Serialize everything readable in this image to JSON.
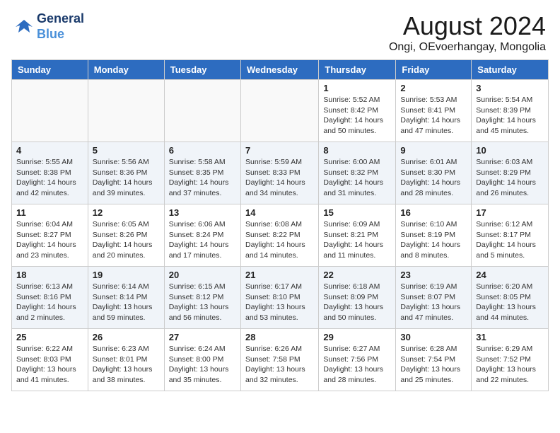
{
  "header": {
    "logo_line1": "General",
    "logo_line2": "Blue",
    "month_year": "August 2024",
    "location": "Ongi, OEvoerhangay, Mongolia"
  },
  "weekdays": [
    "Sunday",
    "Monday",
    "Tuesday",
    "Wednesday",
    "Thursday",
    "Friday",
    "Saturday"
  ],
  "weeks": [
    [
      {
        "day": "",
        "info": ""
      },
      {
        "day": "",
        "info": ""
      },
      {
        "day": "",
        "info": ""
      },
      {
        "day": "",
        "info": ""
      },
      {
        "day": "1",
        "info": "Sunrise: 5:52 AM\nSunset: 8:42 PM\nDaylight: 14 hours and 50 minutes."
      },
      {
        "day": "2",
        "info": "Sunrise: 5:53 AM\nSunset: 8:41 PM\nDaylight: 14 hours and 47 minutes."
      },
      {
        "day": "3",
        "info": "Sunrise: 5:54 AM\nSunset: 8:39 PM\nDaylight: 14 hours and 45 minutes."
      }
    ],
    [
      {
        "day": "4",
        "info": "Sunrise: 5:55 AM\nSunset: 8:38 PM\nDaylight: 14 hours and 42 minutes."
      },
      {
        "day": "5",
        "info": "Sunrise: 5:56 AM\nSunset: 8:36 PM\nDaylight: 14 hours and 39 minutes."
      },
      {
        "day": "6",
        "info": "Sunrise: 5:58 AM\nSunset: 8:35 PM\nDaylight: 14 hours and 37 minutes."
      },
      {
        "day": "7",
        "info": "Sunrise: 5:59 AM\nSunset: 8:33 PM\nDaylight: 14 hours and 34 minutes."
      },
      {
        "day": "8",
        "info": "Sunrise: 6:00 AM\nSunset: 8:32 PM\nDaylight: 14 hours and 31 minutes."
      },
      {
        "day": "9",
        "info": "Sunrise: 6:01 AM\nSunset: 8:30 PM\nDaylight: 14 hours and 28 minutes."
      },
      {
        "day": "10",
        "info": "Sunrise: 6:03 AM\nSunset: 8:29 PM\nDaylight: 14 hours and 26 minutes."
      }
    ],
    [
      {
        "day": "11",
        "info": "Sunrise: 6:04 AM\nSunset: 8:27 PM\nDaylight: 14 hours and 23 minutes."
      },
      {
        "day": "12",
        "info": "Sunrise: 6:05 AM\nSunset: 8:26 PM\nDaylight: 14 hours and 20 minutes."
      },
      {
        "day": "13",
        "info": "Sunrise: 6:06 AM\nSunset: 8:24 PM\nDaylight: 14 hours and 17 minutes."
      },
      {
        "day": "14",
        "info": "Sunrise: 6:08 AM\nSunset: 8:22 PM\nDaylight: 14 hours and 14 minutes."
      },
      {
        "day": "15",
        "info": "Sunrise: 6:09 AM\nSunset: 8:21 PM\nDaylight: 14 hours and 11 minutes."
      },
      {
        "day": "16",
        "info": "Sunrise: 6:10 AM\nSunset: 8:19 PM\nDaylight: 14 hours and 8 minutes."
      },
      {
        "day": "17",
        "info": "Sunrise: 6:12 AM\nSunset: 8:17 PM\nDaylight: 14 hours and 5 minutes."
      }
    ],
    [
      {
        "day": "18",
        "info": "Sunrise: 6:13 AM\nSunset: 8:16 PM\nDaylight: 14 hours and 2 minutes."
      },
      {
        "day": "19",
        "info": "Sunrise: 6:14 AM\nSunset: 8:14 PM\nDaylight: 13 hours and 59 minutes."
      },
      {
        "day": "20",
        "info": "Sunrise: 6:15 AM\nSunset: 8:12 PM\nDaylight: 13 hours and 56 minutes."
      },
      {
        "day": "21",
        "info": "Sunrise: 6:17 AM\nSunset: 8:10 PM\nDaylight: 13 hours and 53 minutes."
      },
      {
        "day": "22",
        "info": "Sunrise: 6:18 AM\nSunset: 8:09 PM\nDaylight: 13 hours and 50 minutes."
      },
      {
        "day": "23",
        "info": "Sunrise: 6:19 AM\nSunset: 8:07 PM\nDaylight: 13 hours and 47 minutes."
      },
      {
        "day": "24",
        "info": "Sunrise: 6:20 AM\nSunset: 8:05 PM\nDaylight: 13 hours and 44 minutes."
      }
    ],
    [
      {
        "day": "25",
        "info": "Sunrise: 6:22 AM\nSunset: 8:03 PM\nDaylight: 13 hours and 41 minutes."
      },
      {
        "day": "26",
        "info": "Sunrise: 6:23 AM\nSunset: 8:01 PM\nDaylight: 13 hours and 38 minutes."
      },
      {
        "day": "27",
        "info": "Sunrise: 6:24 AM\nSunset: 8:00 PM\nDaylight: 13 hours and 35 minutes."
      },
      {
        "day": "28",
        "info": "Sunrise: 6:26 AM\nSunset: 7:58 PM\nDaylight: 13 hours and 32 minutes."
      },
      {
        "day": "29",
        "info": "Sunrise: 6:27 AM\nSunset: 7:56 PM\nDaylight: 13 hours and 28 minutes."
      },
      {
        "day": "30",
        "info": "Sunrise: 6:28 AM\nSunset: 7:54 PM\nDaylight: 13 hours and 25 minutes."
      },
      {
        "day": "31",
        "info": "Sunrise: 6:29 AM\nSunset: 7:52 PM\nDaylight: 13 hours and 22 minutes."
      }
    ]
  ]
}
